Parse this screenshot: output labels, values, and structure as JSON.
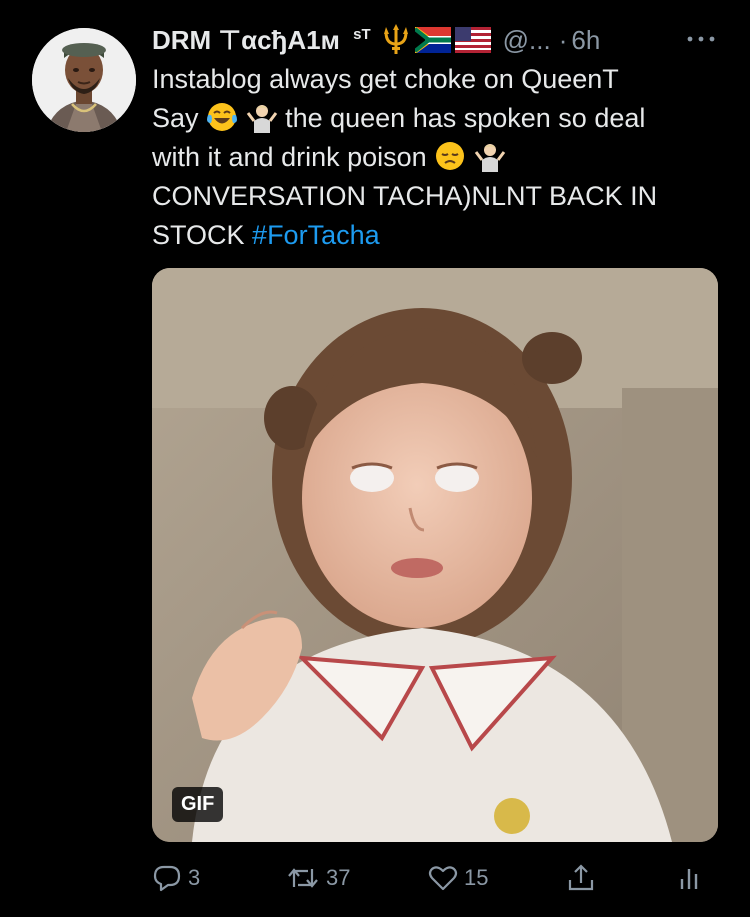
{
  "tweet": {
    "display_name": "DRM ⊤αcђA1ᴍ",
    "name_superscript": "sT",
    "flair_icons": [
      "trident-emoji",
      "south-africa-flag-emoji",
      "us-flag-emoji"
    ],
    "handle": "@...",
    "separator": "·",
    "time": "6h",
    "text_lines": [
      "Instablog always get choke on QueenT",
      "Say",
      "the queen has spoken so deal",
      "with it and drink poison",
      "CONVERSATION TACHA)NLNT BACK IN",
      "STOCK"
    ],
    "hashtag": "#ForTacha",
    "inline_emojis": [
      "face-with-tears-of-joy-emoji",
      "person-shrugging-emoji",
      "disappointed-face-emoji",
      "person-shrugging-emoji"
    ],
    "media": {
      "badge": "GIF"
    },
    "actions": {
      "replies": "3",
      "retweets": "37",
      "likes": "15"
    },
    "colors": {
      "background": "#000000",
      "text": "#e7e9ea",
      "secondary": "#8b98a5",
      "link": "#1d9bf0"
    }
  }
}
